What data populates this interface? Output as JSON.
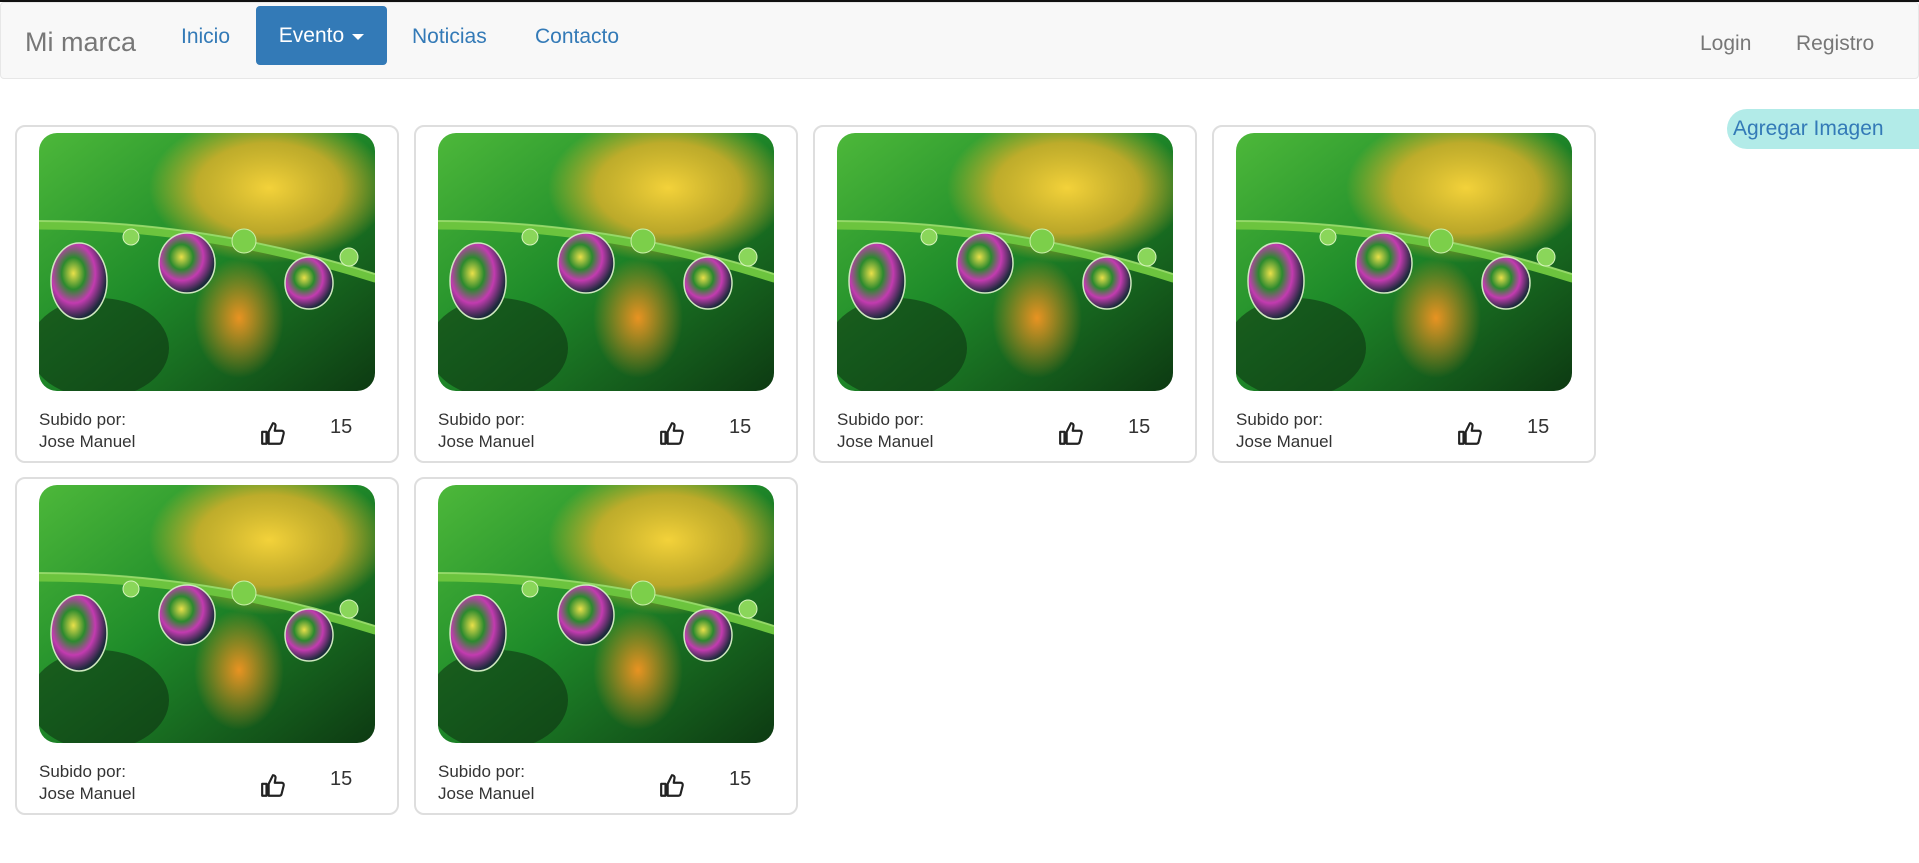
{
  "navbar": {
    "brand": "Mi marca",
    "links": [
      {
        "label": "Inicio"
      },
      {
        "label": "Evento"
      },
      {
        "label": "Noticias"
      },
      {
        "label": "Contacto"
      }
    ],
    "right": [
      {
        "label": "Login"
      },
      {
        "label": "Registro"
      }
    ]
  },
  "actions": {
    "add_image": "Agregar Imagen"
  },
  "cards": [
    {
      "uploaded_by_label": "Subido por:",
      "uploader": "Jose Manuel",
      "likes": "15"
    },
    {
      "uploaded_by_label": "Subido por:",
      "uploader": "Jose Manuel",
      "likes": "15"
    },
    {
      "uploaded_by_label": "Subido por:",
      "uploader": "Jose Manuel",
      "likes": "15"
    },
    {
      "uploaded_by_label": "Subido por:",
      "uploader": "Jose Manuel",
      "likes": "15"
    },
    {
      "uploaded_by_label": "Subido por:",
      "uploader": "Jose Manuel",
      "likes": "15"
    },
    {
      "uploaded_by_label": "Subido por:",
      "uploader": "Jose Manuel",
      "likes": "15"
    }
  ],
  "colors": {
    "primary": "#337ab7",
    "navbar_bg": "#f8f8f8",
    "add_button_bg": "#b2ebe8",
    "card_border": "#dedede"
  },
  "icons": {
    "like": "thumbs-up-icon",
    "dropdown": "caret-down-icon"
  }
}
